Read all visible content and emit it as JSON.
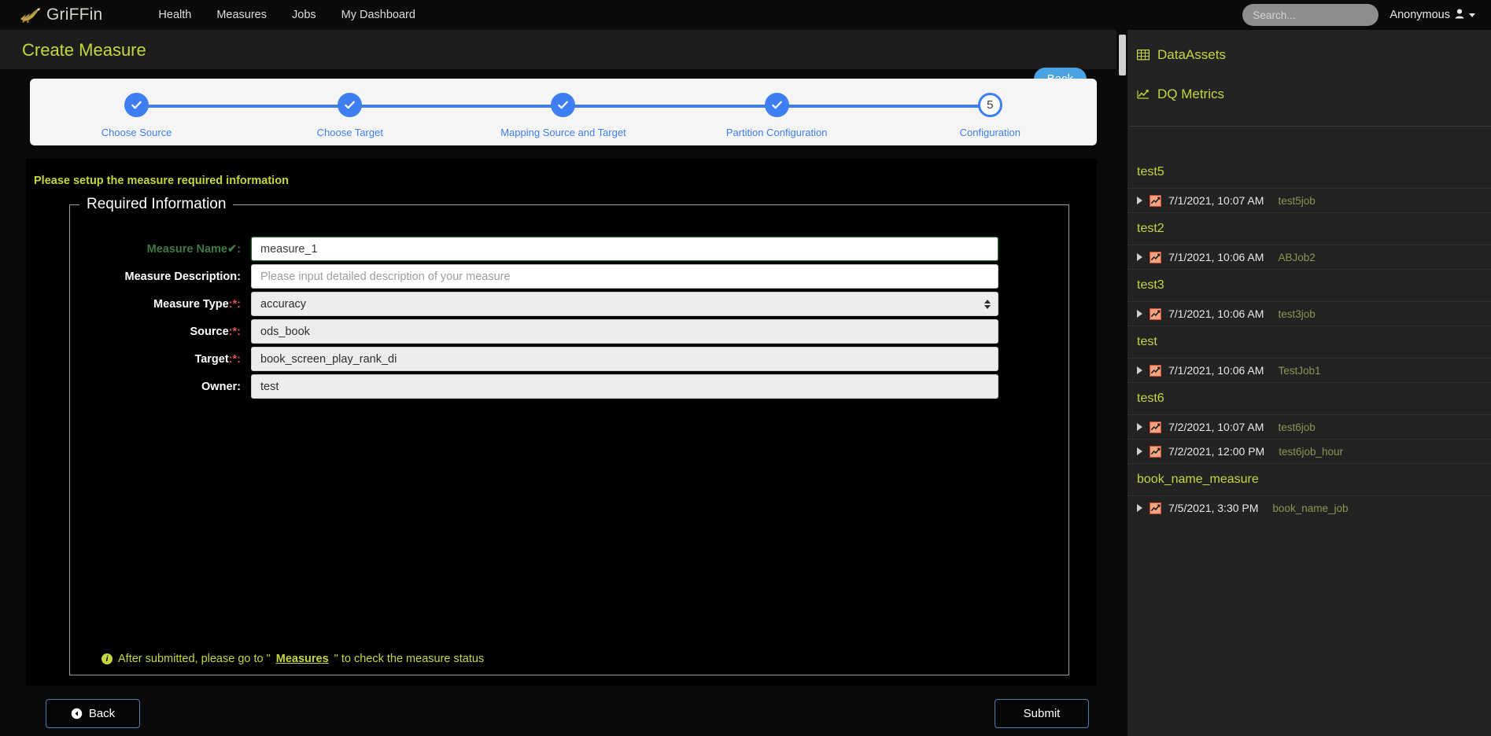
{
  "navbar": {
    "brand": "GriFFin",
    "brand_icon": "griffin-bird-logo",
    "links": [
      {
        "label": "Health",
        "name": "health"
      },
      {
        "label": "Measures",
        "name": "measures"
      },
      {
        "label": "Jobs",
        "name": "jobs"
      },
      {
        "label": "My Dashboard",
        "name": "my-dashboard"
      }
    ],
    "search": {
      "value": "",
      "placeholder": "Search..."
    },
    "user": {
      "label": "Anonymous",
      "icon": "user-icon"
    }
  },
  "page": {
    "title": "Create Measure",
    "top_back_label": "Back"
  },
  "wizard": {
    "steps": [
      {
        "label": "Choose Source",
        "state": "done",
        "marker": "check"
      },
      {
        "label": "Choose Target",
        "state": "done",
        "marker": "check"
      },
      {
        "label": "Mapping Source and Target",
        "state": "done",
        "marker": "check"
      },
      {
        "label": "Partition Configuration",
        "state": "done",
        "marker": "check"
      },
      {
        "label": "Configuration",
        "state": "current",
        "marker": "5"
      }
    ],
    "accent_color": "#3d7ef0"
  },
  "form": {
    "notice": "Please setup the measure required information",
    "legend": "Required Information",
    "fields": [
      {
        "label": "Measure Name",
        "suffix": ":",
        "valid_check": "✔",
        "required": false,
        "type": "text",
        "value": "measure_1",
        "placeholder": "",
        "state": "valid"
      },
      {
        "label": "Measure Description",
        "suffix": ":",
        "required": false,
        "type": "text",
        "value": "",
        "placeholder": "Please input detailed description of your measure",
        "state": "normal"
      },
      {
        "label": "Measure Type",
        "suffix": ":*:",
        "required": true,
        "type": "select",
        "value": "accuracy",
        "state": "normal"
      },
      {
        "label": "Source",
        "suffix": ":*:",
        "required": true,
        "type": "readonly",
        "value": "ods_book",
        "state": "normal"
      },
      {
        "label": "Target",
        "suffix": ":*:",
        "required": true,
        "type": "readonly",
        "value": "book_screen_play_rank_di",
        "state": "normal"
      },
      {
        "label": "Owner",
        "suffix": ":",
        "required": false,
        "type": "readonly",
        "value": "test",
        "state": "normal"
      }
    ],
    "footer_note_pre": "After submitted, please go to \"",
    "footer_note_link": "Measures",
    "footer_note_post": "\" to check the measure status",
    "info_icon": "info-icon"
  },
  "buttons": {
    "back_label": "Back",
    "submit_label": "Submit",
    "back_icon": "arrow-circle-left-icon"
  },
  "sidebar": {
    "links": [
      {
        "label": "DataAssets",
        "icon": "table-grid-icon"
      },
      {
        "label": "DQ Metrics",
        "icon": "line-chart-icon"
      }
    ],
    "groups": [
      {
        "title": "test5",
        "rows": [
          {
            "time": "7/1/2021, 10:07 AM",
            "job": "test5job",
            "icon": "chart-icon",
            "expander": "triangle-right-icon"
          }
        ]
      },
      {
        "title": "test2",
        "rows": [
          {
            "time": "7/1/2021, 10:06 AM",
            "job": "ABJob2",
            "icon": "chart-icon",
            "expander": "triangle-right-icon"
          }
        ]
      },
      {
        "title": "test3",
        "rows": [
          {
            "time": "7/1/2021, 10:06 AM",
            "job": "test3job",
            "icon": "chart-icon",
            "expander": "triangle-right-icon"
          }
        ]
      },
      {
        "title": "test",
        "rows": [
          {
            "time": "7/1/2021, 10:06 AM",
            "job": "TestJob1",
            "icon": "chart-icon",
            "expander": "triangle-right-icon"
          }
        ]
      },
      {
        "title": "test6",
        "rows": [
          {
            "time": "7/2/2021, 10:07 AM",
            "job": "test6job",
            "icon": "chart-icon",
            "expander": "triangle-right-icon"
          },
          {
            "time": "7/2/2021, 12:00 PM",
            "job": "test6job_hour",
            "icon": "chart-icon",
            "expander": "triangle-right-icon"
          }
        ]
      },
      {
        "title": "book_name_measure",
        "rows": [
          {
            "time": "7/5/2021, 3:30 PM",
            "job": "book_name_job",
            "icon": "chart-icon",
            "expander": "triangle-right-icon"
          }
        ]
      }
    ]
  },
  "colors": {
    "accent_green": "#c6d63f",
    "accent_blue": "#3d7ef0",
    "button_blue": "#4ba3e3",
    "valid_green": "#3f7a3f",
    "required_red": "#d9534f"
  }
}
